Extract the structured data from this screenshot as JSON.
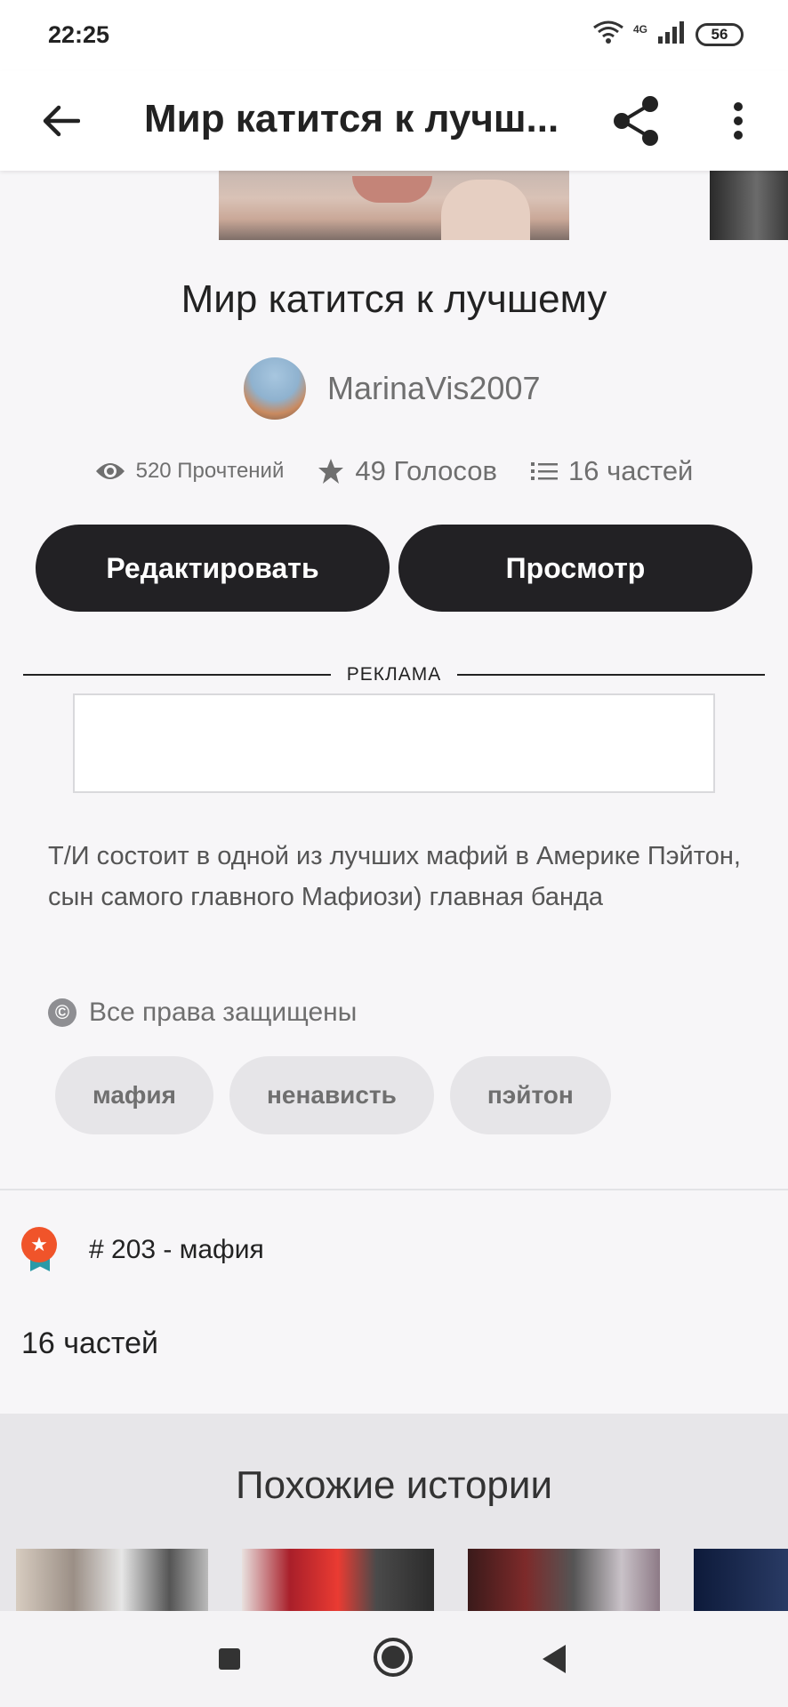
{
  "status_bar": {
    "time": "22:25",
    "network": "4G",
    "battery": "56",
    "icons": [
      "wifi-icon",
      "signal-icon",
      "battery-icon"
    ]
  },
  "app_bar": {
    "title": "Мир катится к лучш...",
    "icons": [
      "back-arrow-icon",
      "share-icon",
      "more-vert-icon"
    ]
  },
  "story": {
    "title": "Мир катится к лучшему",
    "author": "MarinaVis2007",
    "stats": {
      "reads": "520 Прочтений",
      "votes": "49 Голосов",
      "parts": "16 частей"
    },
    "buttons": {
      "edit": "Редактировать",
      "view": "Просмотр"
    },
    "ad_label": "РЕКЛАМА",
    "description": "Т/И состоит в одной из лучших мафий в Америке Пэйтон, сын самого главного Мафиози) главная банда",
    "copyright": "Все права защищены",
    "tags": [
      "мафия",
      "ненависть",
      "пэйтон"
    ],
    "rank": "# 203 - мафия",
    "parts_count": "16 частей"
  },
  "similar": {
    "title": "Похожие истории"
  },
  "colors": {
    "button_bg": "#222124",
    "tag_bg": "#e6e5e8",
    "rank_medal": "#f0542a",
    "rank_ribbon": "#2a9aa8"
  }
}
